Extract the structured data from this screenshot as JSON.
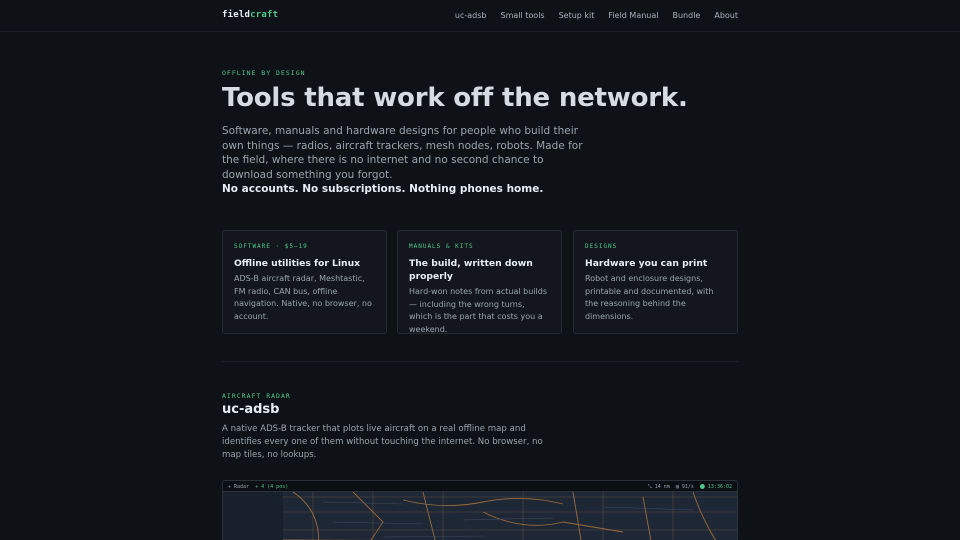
{
  "header": {
    "logo_a": "field",
    "logo_b": "craft",
    "nav": [
      "uc-adsb",
      "Small tools",
      "Setup kit",
      "Field Manual",
      "Bundle",
      "About"
    ]
  },
  "hero": {
    "eyebrow": "OFFLINE BY DESIGN",
    "title": "Tools that work off the network.",
    "text": "Software, manuals and hardware designs for people who build their own things — radios, aircraft trackers, mesh nodes, robots. Made for the field, where there is no internet and no second chance to download something you forgot.",
    "strong": "No accounts. No subscriptions. Nothing phones home."
  },
  "cards": [
    {
      "eyebrow": "SOFTWARE · $5–19",
      "title": "Offline utilities for Linux",
      "text": "ADS-B aircraft radar, Meshtastic, FM radio, CAN bus, offline navigation. Native, no browser, no account."
    },
    {
      "eyebrow": "MANUALS & KITS",
      "title": "The build, written down properly",
      "text": "Hard-won notes from actual builds — including the wrong turns, which is the part that costs you a weekend."
    },
    {
      "eyebrow": "DESIGNS",
      "title": "Hardware you can print",
      "text": "Robot and enclosure designs, printable and documented, with the reasoning behind the dimensions."
    }
  ],
  "section": {
    "eyebrow": "AIRCRAFT RADAR",
    "title": "uc-adsb",
    "text": "A native ADS-B tracker that plots live aircraft on a real offline map and identifies every one of them without touching the internet. No browser, no map tiles, no lookups."
  },
  "radar": {
    "title": "✈ Radar",
    "count": "✈ 4 (4 pos)",
    "range": "⤡ 14 nm",
    "status": "⬤ 13:36:02",
    "grid": "▥ 91/s"
  },
  "colors": {
    "accent": "#4ec98a",
    "background": "#0e1116",
    "card": "#13171d"
  }
}
